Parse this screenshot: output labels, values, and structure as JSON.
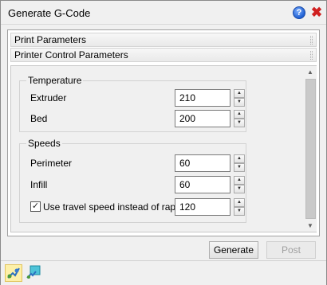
{
  "window": {
    "title": "Generate G-Code"
  },
  "sections": {
    "print_parameters": "Print Parameters",
    "printer_control": "Printer Control Parameters"
  },
  "temperature": {
    "label": "Temperature",
    "extruder_label": "Extruder",
    "extruder_value": "210",
    "bed_label": "Bed",
    "bed_value": "200"
  },
  "speeds": {
    "label": "Speeds",
    "perimeter_label": "Perimeter",
    "perimeter_value": "60",
    "infill_label": "Infill",
    "infill_value": "60",
    "travel_checkbox_label": "Use travel speed instead of rapid",
    "travel_checked": true,
    "travel_value": "120"
  },
  "buttons": {
    "generate": "Generate",
    "post": "Post"
  },
  "icons": {
    "help": "help-icon",
    "close": "close-icon",
    "tool1": "gcode-tool-icon",
    "tool2": "preview-tool-icon"
  },
  "colors": {
    "close": "#d02020",
    "help": "#1f5fd1",
    "active_tool_bg": "#fdf0a8"
  }
}
